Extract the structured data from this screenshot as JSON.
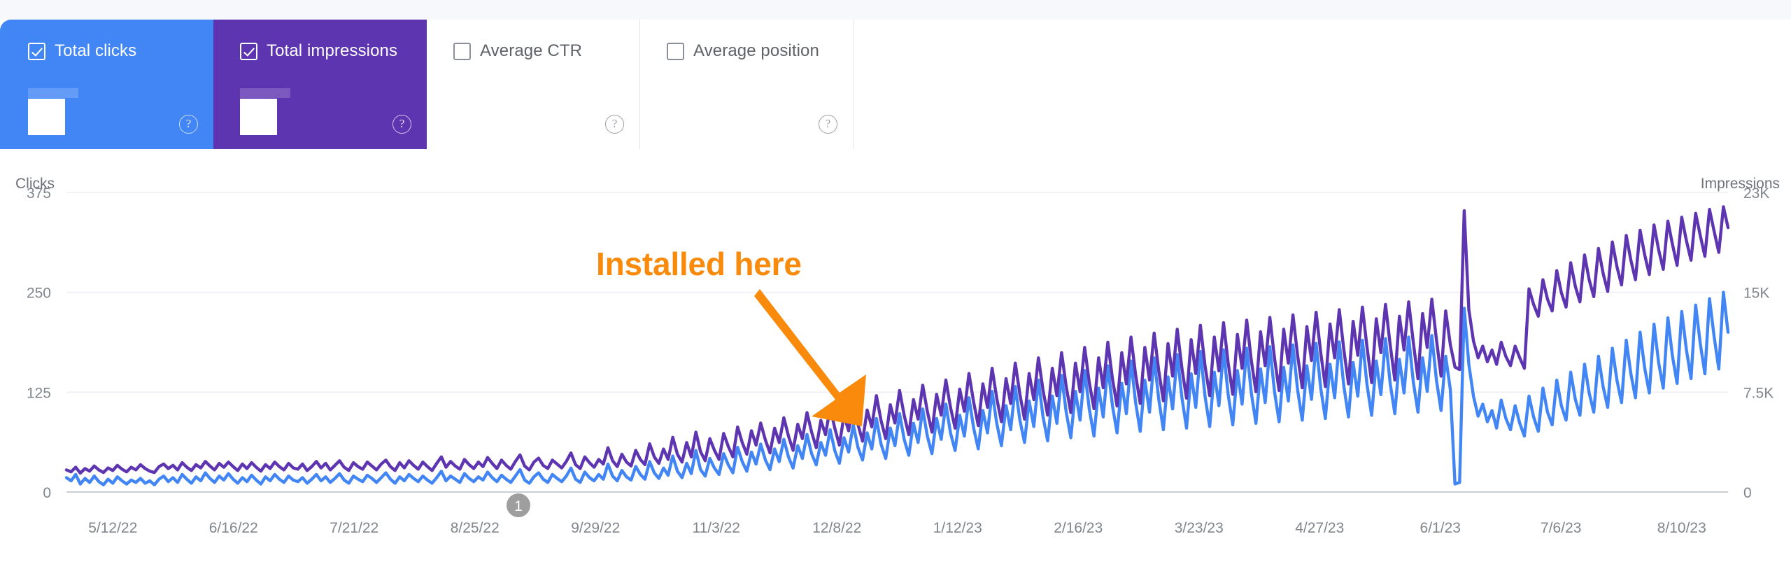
{
  "metrics": {
    "cards": [
      {
        "label": "Total clicks",
        "checked": true,
        "selected": true,
        "value_redacted": true,
        "help": "?",
        "accent": "#4285f4"
      },
      {
        "label": "Total impressions",
        "checked": true,
        "selected": true,
        "value_redacted": true,
        "help": "?",
        "accent": "#5e35b1"
      },
      {
        "label": "Average CTR",
        "checked": false,
        "selected": false,
        "value_redacted": false,
        "help": "?",
        "accent": "#00897b"
      },
      {
        "label": "Average position",
        "checked": false,
        "selected": false,
        "value_redacted": false,
        "help": "?",
        "accent": "#e8710a"
      }
    ]
  },
  "annotation": {
    "text": "Installed here",
    "color": "#f98a0b"
  },
  "marker": {
    "badge_label": "1"
  },
  "chart_data": {
    "type": "line",
    "title": "",
    "grid": true,
    "legend": "metric-cards-above",
    "left_axis": {
      "label": "Clicks",
      "ticks": [
        "375",
        "250",
        "125",
        "0"
      ],
      "tick_values": [
        375,
        250,
        125,
        0
      ],
      "ylim": [
        0,
        375
      ]
    },
    "right_axis": {
      "label": "Impressions",
      "ticks": [
        "23K",
        "15K",
        "7.5K",
        "0"
      ],
      "tick_values": [
        23000,
        15000,
        7500,
        0
      ],
      "ylim": [
        0,
        23000
      ]
    },
    "xlabel": "",
    "x_tick_labels": [
      "5/12/22",
      "6/16/22",
      "7/21/22",
      "8/25/22",
      "9/29/22",
      "11/3/22",
      "12/8/22",
      "1/12/23",
      "2/16/23",
      "3/23/23",
      "4/27/23",
      "6/1/23",
      "7/6/23",
      "8/10/23"
    ],
    "series": [
      {
        "name": "Total clicks",
        "color": "#4285f4",
        "axis": "left",
        "values": [
          18,
          14,
          22,
          10,
          17,
          12,
          20,
          13,
          9,
          16,
          11,
          19,
          14,
          10,
          15,
          12,
          17,
          11,
          14,
          9,
          16,
          20,
          13,
          18,
          12,
          22,
          16,
          11,
          19,
          14,
          24,
          17,
          12,
          20,
          15,
          23,
          16,
          11,
          18,
          13,
          21,
          15,
          10,
          19,
          14,
          22,
          16,
          12,
          20,
          15,
          13,
          18,
          11,
          16,
          22,
          14,
          19,
          12,
          17,
          23,
          15,
          11,
          20,
          16,
          13,
          21,
          17,
          12,
          18,
          24,
          16,
          11,
          19,
          14,
          22,
          17,
          13,
          20,
          15,
          11,
          18,
          26,
          14,
          20,
          16,
          12,
          23,
          17,
          13,
          19,
          15,
          25,
          18,
          13,
          21,
          16,
          12,
          20,
          28,
          15,
          11,
          19,
          24,
          16,
          12,
          22,
          17,
          13,
          20,
          30,
          16,
          12,
          25,
          18,
          14,
          22,
          16,
          35,
          20,
          14,
          27,
          19,
          15,
          32,
          22,
          16,
          38,
          24,
          17,
          30,
          21,
          45,
          26,
          18,
          36,
          23,
          52,
          28,
          20,
          42,
          30,
          22,
          48,
          34,
          24,
          56,
          38,
          26,
          50,
          35,
          60,
          40,
          28,
          54,
          38,
          66,
          44,
          30,
          58,
          42,
          72,
          48,
          34,
          62,
          46,
          78,
          52,
          36,
          68,
          50,
          84,
          56,
          40,
          74,
          54,
          92,
          60,
          42,
          80,
          58,
          98,
          66,
          46,
          86,
          62,
          104,
          70,
          48,
          92,
          66,
          110,
          74,
          52,
          96,
          70,
          118,
          80,
          54,
          102,
          74,
          126,
          86,
          58,
          108,
          78,
          132,
          90,
          62,
          114,
          82,
          140,
          94,
          64,
          120,
          86,
          146,
          100,
          68,
          126,
          90,
          152,
          104,
          70,
          130,
          94,
          158,
          108,
          74,
          136,
          98,
          164,
          112,
          76,
          140,
          100,
          168,
          116,
          78,
          144,
          104,
          172,
          118,
          80,
          148,
          106,
          176,
          120,
          82,
          150,
          108,
          178,
          122,
          84,
          152,
          110,
          180,
          124,
          86,
          154,
          112,
          182,
          126,
          88,
          156,
          114,
          184,
          128,
          90,
          158,
          116,
          186,
          130,
          92,
          160,
          118,
          188,
          132,
          94,
          162,
          120,
          190,
          134,
          96,
          164,
          122,
          192,
          136,
          98,
          166,
          124,
          194,
          138,
          100,
          168,
          126,
          196,
          140,
          102,
          170,
          128,
          10,
          12,
          230,
          160,
          120,
          95,
          110,
          88,
          102,
          80,
          115,
          92,
          78,
          108,
          86,
          70,
          120,
          94,
          76,
          130,
          100,
          84,
          140,
          108,
          90,
          150,
          116,
          96,
          160,
          124,
          100,
          170,
          132,
          106,
          180,
          140,
          112,
          190,
          148,
          118,
          200,
          155,
          124,
          210,
          162,
          130,
          218,
          170,
          136,
          226,
          178,
          142,
          234,
          186,
          148,
          242,
          194,
          154,
          250,
          200
        ]
      },
      {
        "name": "Total impressions",
        "color": "#5e35b1",
        "axis": "right",
        "values": [
          1700,
          1550,
          1900,
          1450,
          1800,
          1600,
          2000,
          1700,
          1500,
          1850,
          1650,
          2050,
          1750,
          1550,
          1900,
          1700,
          2100,
          1800,
          1600,
          1500,
          1950,
          2150,
          1800,
          2050,
          1700,
          2250,
          1900,
          1650,
          2100,
          1850,
          2350,
          2000,
          1700,
          2200,
          1900,
          2300,
          1950,
          1650,
          2150,
          1800,
          2250,
          1900,
          1600,
          2100,
          1800,
          2300,
          1950,
          1700,
          2200,
          1850,
          1750,
          2150,
          1650,
          1950,
          2350,
          1850,
          2200,
          1700,
          2050,
          2400,
          1900,
          1650,
          2250,
          1950,
          1750,
          2300,
          2000,
          1700,
          2150,
          2450,
          1950,
          1650,
          2250,
          1850,
          2400,
          2050,
          1750,
          2300,
          1950,
          1650,
          2200,
          2700,
          1900,
          2350,
          2000,
          1750,
          2500,
          2100,
          1800,
          2300,
          1950,
          2650,
          2200,
          1800,
          2450,
          2050,
          1750,
          2350,
          2850,
          2000,
          1700,
          2300,
          2600,
          2050,
          1800,
          2450,
          2150,
          1850,
          2350,
          3000,
          2100,
          1800,
          2700,
          2250,
          1900,
          2500,
          2150,
          3400,
          2400,
          1950,
          2900,
          2300,
          2000,
          3200,
          2500,
          2100,
          3700,
          2700,
          2200,
          3300,
          2500,
          4200,
          2900,
          2300,
          3800,
          2700,
          4600,
          3100,
          2400,
          4100,
          3200,
          2500,
          4500,
          3500,
          2700,
          5000,
          3800,
          2900,
          4700,
          3600,
          5300,
          4000,
          3000,
          4900,
          3800,
          5700,
          4300,
          3200,
          5200,
          4100,
          6100,
          4600,
          3400,
          5500,
          4400,
          6500,
          4900,
          3600,
          5900,
          4700,
          6900,
          5200,
          3900,
          6300,
          5000,
          7400,
          5500,
          4100,
          6700,
          5300,
          7800,
          5900,
          4400,
          7100,
          5600,
          8200,
          6200,
          4600,
          7500,
          5900,
          8600,
          6500,
          4900,
          7900,
          6200,
          9100,
          6900,
          5100,
          8300,
          6500,
          9500,
          7200,
          5400,
          8700,
          6800,
          9900,
          7500,
          5600,
          9100,
          7100,
          10300,
          7800,
          5900,
          9500,
          7400,
          10700,
          8100,
          6100,
          9900,
          7700,
          11100,
          8400,
          6400,
          10300,
          8000,
          11500,
          8700,
          6600,
          10700,
          8300,
          11900,
          9000,
          6800,
          11100,
          8600,
          12200,
          9300,
          7000,
          11400,
          8900,
          12500,
          9500,
          7200,
          11700,
          9100,
          12800,
          9700,
          7400,
          11900,
          9300,
          13000,
          9900,
          7500,
          12100,
          9500,
          13200,
          10100,
          7700,
          12300,
          9700,
          13400,
          10300,
          7800,
          12500,
          9900,
          13600,
          10500,
          8000,
          12700,
          10100,
          13800,
          10700,
          8100,
          12900,
          10300,
          14000,
          10900,
          8300,
          13100,
          10500,
          14200,
          11100,
          8400,
          13300,
          10700,
          14400,
          11300,
          8600,
          13500,
          10900,
          14600,
          11500,
          8700,
          13700,
          11100,
          14800,
          11700,
          8900,
          13900,
          11300,
          9600,
          9400,
          21600,
          14000,
          11600,
          10300,
          11200,
          10000,
          10900,
          9800,
          11500,
          10400,
          9700,
          11200,
          10300,
          9500,
          15600,
          14400,
          13500,
          16300,
          14800,
          13900,
          17000,
          15300,
          14200,
          17600,
          15800,
          14600,
          18200,
          16300,
          15000,
          18700,
          16800,
          15400,
          19200,
          17300,
          15900,
          19700,
          17800,
          16300,
          20100,
          18200,
          16700,
          20500,
          18600,
          17100,
          20800,
          19000,
          17400,
          21100,
          19300,
          17800,
          21400,
          19700,
          18100,
          21700,
          20000,
          18400,
          21900,
          20300
        ]
      }
    ]
  }
}
